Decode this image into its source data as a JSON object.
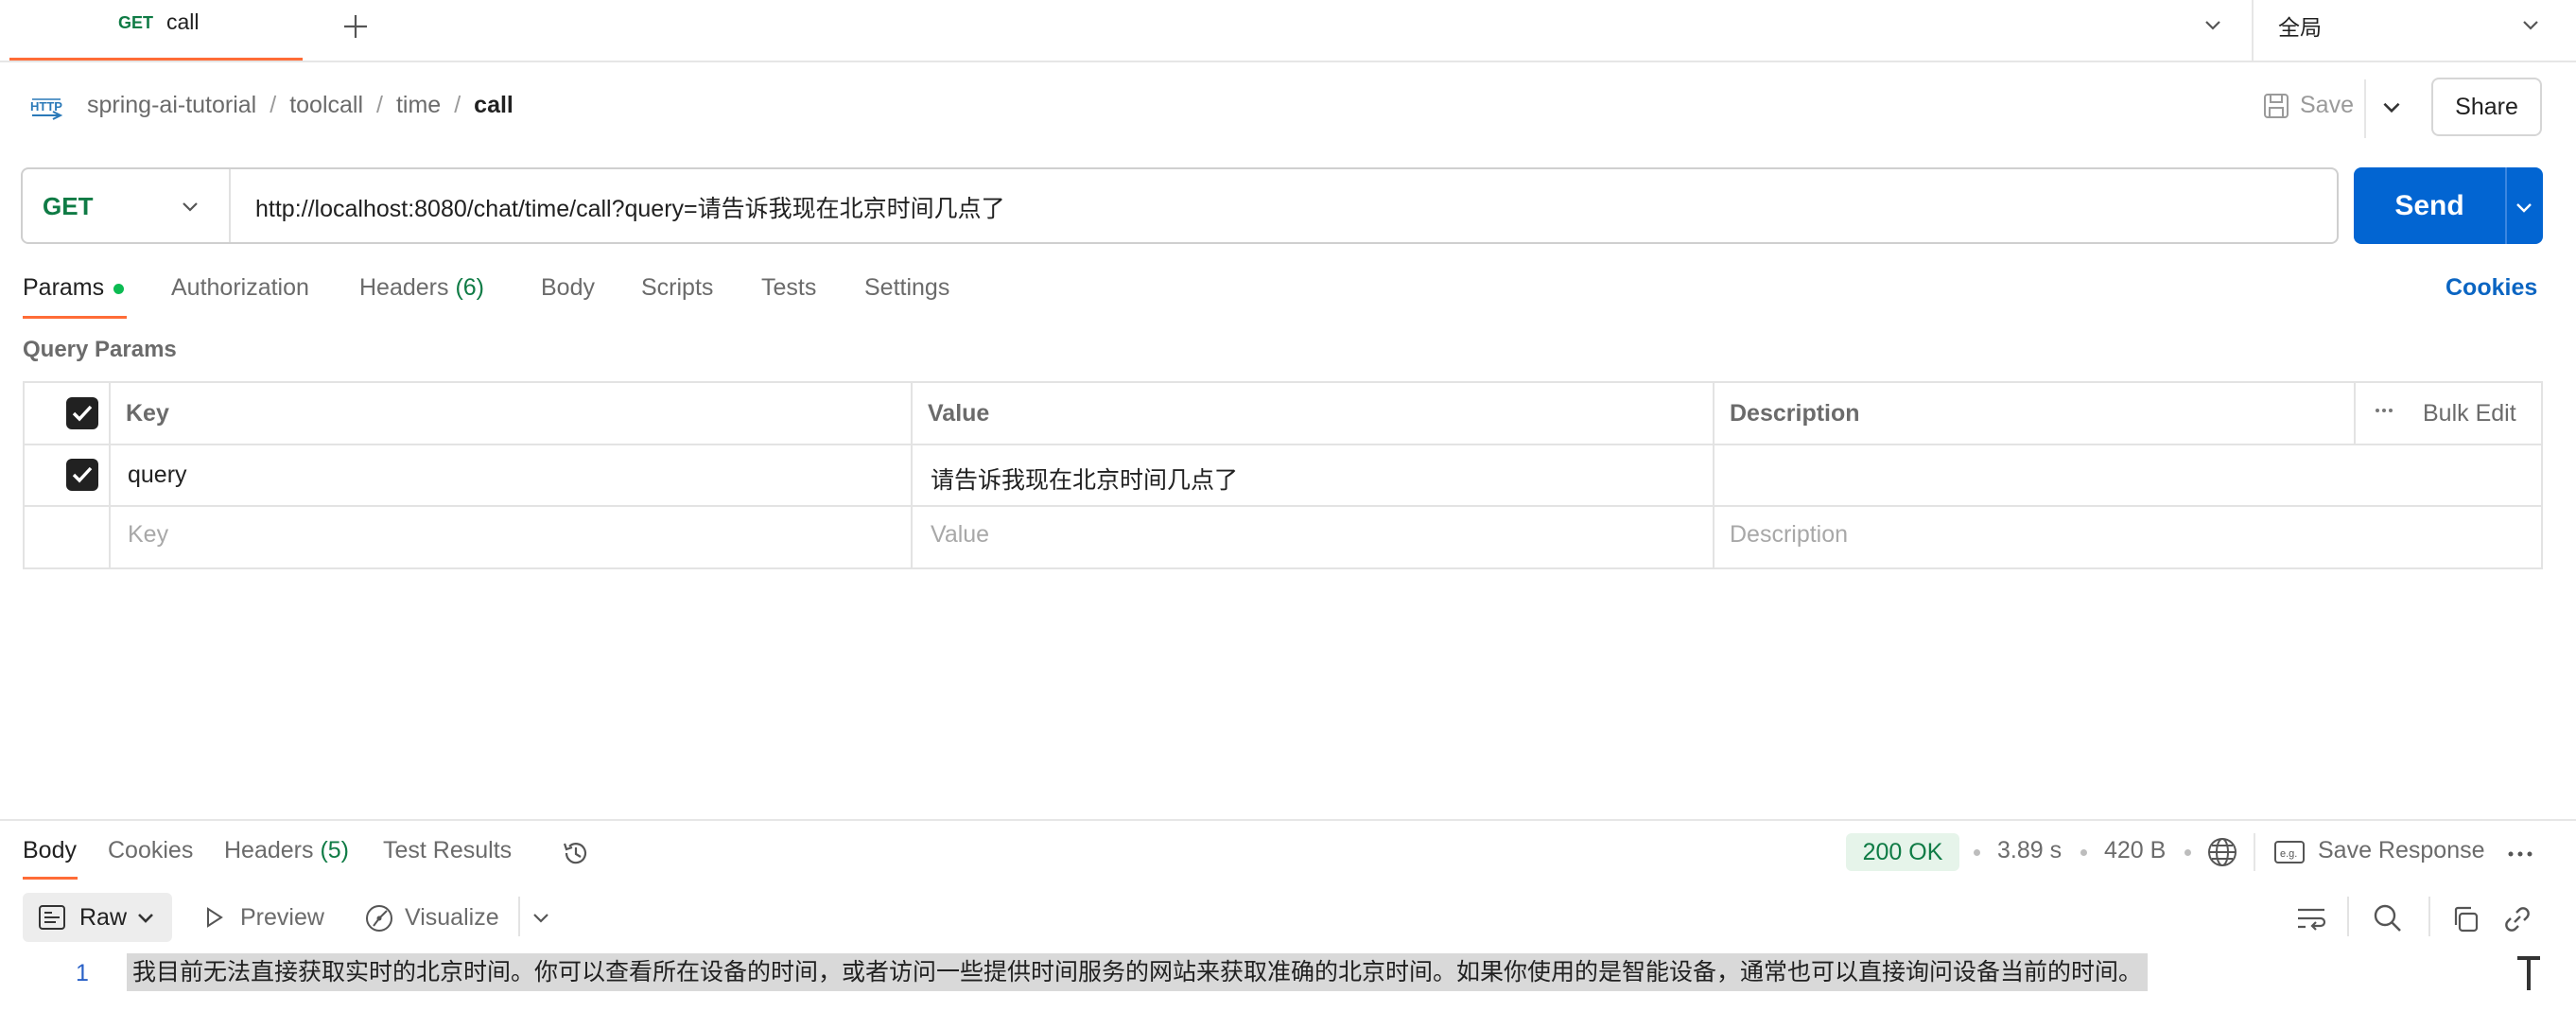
{
  "tab": {
    "method": "GET",
    "name": "call"
  },
  "environment": {
    "label": "全局"
  },
  "breadcrumb": {
    "items": [
      "spring-ai-tutorial",
      "toolcall",
      "time"
    ],
    "current": "call"
  },
  "toolbar": {
    "save_label": "Save",
    "share_label": "Share"
  },
  "request": {
    "method": "GET",
    "url": "http://localhost:8080/chat/time/call?query=请告诉我现在北京时间几点了",
    "send_label": "Send"
  },
  "request_tabs": {
    "params": "Params",
    "authorization": "Authorization",
    "headers": "Headers",
    "headers_count": "(6)",
    "body": "Body",
    "scripts": "Scripts",
    "tests": "Tests",
    "settings": "Settings",
    "cookies": "Cookies"
  },
  "query_params": {
    "title": "Query Params",
    "columns": {
      "key": "Key",
      "value": "Value",
      "description": "Description",
      "bulk_edit": "Bulk Edit"
    },
    "rows": [
      {
        "checked": true,
        "key": "query",
        "value": "请告诉我现在北京时间几点了",
        "description": ""
      }
    ],
    "placeholders": {
      "key": "Key",
      "value": "Value",
      "description": "Description"
    }
  },
  "response": {
    "tabs": {
      "body": "Body",
      "cookies": "Cookies",
      "headers": "Headers",
      "headers_count": "(5)",
      "test_results": "Test Results"
    },
    "status": "200 OK",
    "time": "3.89 s",
    "size": "420 B",
    "save_response": "Save Response",
    "format": {
      "raw": "Raw",
      "preview": "Preview",
      "visualize": "Visualize"
    },
    "lines": [
      {
        "num": "1",
        "text": "我目前无法直接获取实时的北京时间。你可以查看所在设备的时间，或者访问一些提供时间服务的网站来获取准确的北京时间。如果你使用的是智能设备，通常也可以直接询问设备当前的时间。"
      }
    ]
  },
  "colors": {
    "accent": "#ff6c37",
    "send": "#0265d2",
    "method_get": "#0f7b45",
    "link": "#0b65c2",
    "status_ok_bg": "#e6f4ea"
  }
}
